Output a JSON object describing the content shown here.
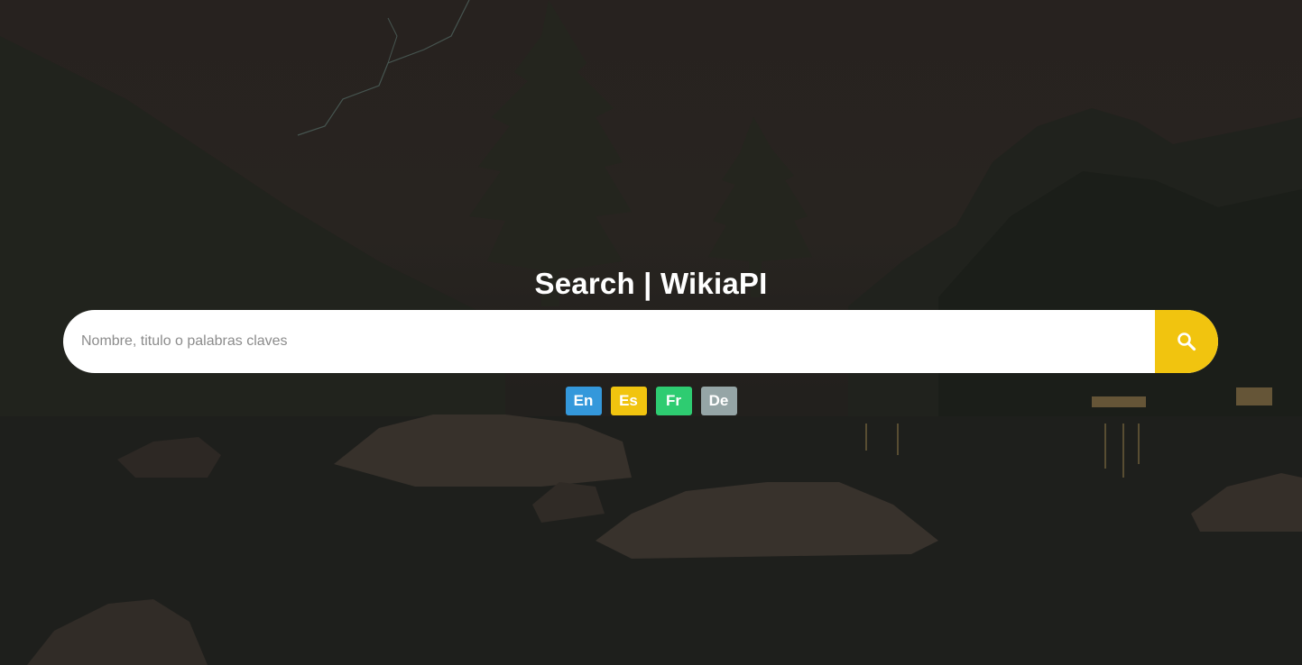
{
  "page": {
    "title": "Search | WikiaPI"
  },
  "search": {
    "placeholder": "Nombre, titulo o palabras claves",
    "value": "",
    "button_icon": "search-icon",
    "button_color": "#f1c40f"
  },
  "languages": [
    {
      "label": "En",
      "color": "#3498db"
    },
    {
      "label": "Es",
      "color": "#f1c40f"
    },
    {
      "label": "Fr",
      "color": "#2ecc71"
    },
    {
      "label": "De",
      "color": "#95a5a6"
    }
  ]
}
